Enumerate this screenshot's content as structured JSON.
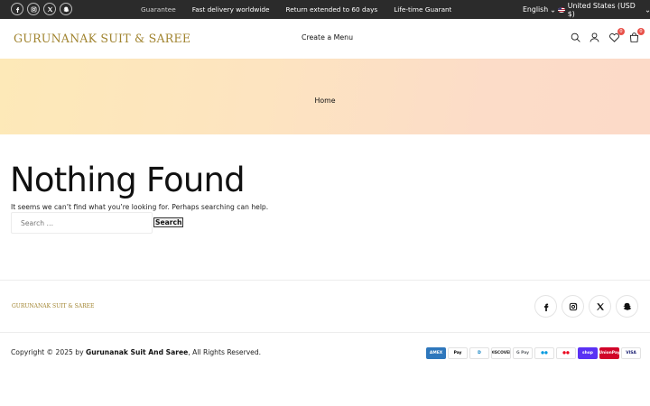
{
  "topbar": {
    "social": [
      "facebook-icon",
      "instagram-icon",
      "x-icon",
      "snapchat-icon"
    ],
    "messages": [
      "Guarantee",
      "Fast delivery worldwide",
      "Return extended to 60 days",
      "Life-time Guarantee"
    ],
    "language": "English",
    "currency": "United States (USD $)"
  },
  "header": {
    "logo": "GURUNANAK SUIT & SAREE",
    "menu_link": "Create a Menu",
    "wishlist_count": "0",
    "cart_count": "0"
  },
  "banner": {
    "breadcrumb": "Home"
  },
  "main": {
    "title": "Nothing Found",
    "text": "It seems we can’t find what you’re looking for. Perhaps searching can help.",
    "search_placeholder": "Search …",
    "search_button": "Search"
  },
  "footer": {
    "logo": "GURUNANAK SUIT & SAREE",
    "social": [
      "facebook-icon",
      "instagram-icon",
      "x-icon",
      "snapchat-icon"
    ],
    "copyright_prefix": "Copyright © 2025 by ",
    "copyright_brand": "Gurunanak Suit And Saree",
    "copyright_suffix": ", All Rights Reserved.",
    "payments": [
      {
        "name": "American Express",
        "label": "AMEX",
        "bg": "#2e77bc",
        "fg": "#ffffff"
      },
      {
        "name": "Apple Pay",
        "label": "Pay",
        "bg": "#ffffff",
        "fg": "#000000"
      },
      {
        "name": "Diners Club",
        "label": "D",
        "bg": "#ffffff",
        "fg": "#0079be"
      },
      {
        "name": "Discover",
        "label": "DISCOVER",
        "bg": "#ffffff",
        "fg": "#222222"
      },
      {
        "name": "Google Pay",
        "label": "G Pay",
        "bg": "#ffffff",
        "fg": "#5f6368"
      },
      {
        "name": "Maestro",
        "label": "●●",
        "bg": "#ffffff",
        "fg": "#0099df"
      },
      {
        "name": "Mastercard",
        "label": "●●",
        "bg": "#ffffff",
        "fg": "#eb001b"
      },
      {
        "name": "Shop Pay",
        "label": "shop",
        "bg": "#5a31f4",
        "fg": "#ffffff"
      },
      {
        "name": "UnionPay",
        "label": "UnionPay",
        "bg": "#d10429",
        "fg": "#ffffff"
      },
      {
        "name": "Visa",
        "label": "VISA",
        "bg": "#ffffff",
        "fg": "#1a1f71"
      }
    ]
  }
}
